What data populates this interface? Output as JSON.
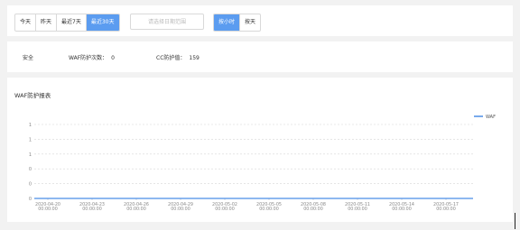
{
  "filters": {
    "ranges": [
      {
        "label": "今天",
        "active": false
      },
      {
        "label": "昨天",
        "active": false
      },
      {
        "label": "最近7天",
        "active": false
      },
      {
        "label": "最近30天",
        "active": true
      }
    ],
    "date_placeholder": "请选择日期范围",
    "units": [
      {
        "label": "按小时",
        "active": true
      },
      {
        "label": "按天",
        "active": false
      }
    ]
  },
  "stats": {
    "safe_label": "安全",
    "waf_label": "WAF防护次数：",
    "waf_value": "0",
    "cc_label": "CC防护值：",
    "cc_value": "159"
  },
  "chart": {
    "title": "WAF防护报表"
  },
  "colors": {
    "accent": "#5b9cf0",
    "series": "#4a8de6"
  },
  "chart_data": {
    "type": "line",
    "title": "WAF防护报表",
    "x_tick_labels": [
      [
        "2020-04-20",
        "00:00:00"
      ],
      [
        "2020-04-23",
        "00:00:00"
      ],
      [
        "2020-04-26",
        "00:00:00"
      ],
      [
        "2020-04-29",
        "00:00:00"
      ],
      [
        "2020-05-02",
        "00:00:00"
      ],
      [
        "2020-05-05",
        "00:00:00"
      ],
      [
        "2020-05-08",
        "00:00:00"
      ],
      [
        "2020-05-11",
        "00:00:00"
      ],
      [
        "2020-05-14",
        "00:00:00"
      ],
      [
        "2020-05-17",
        "00:00:00"
      ]
    ],
    "y_tick_labels": [
      "0",
      "0",
      "0",
      "1",
      "1",
      "1"
    ],
    "ylim": [
      0,
      1
    ],
    "series": [
      {
        "name": "WAF",
        "x": [
          "2020-04-20",
          "2020-05-20"
        ],
        "y": [
          0,
          0
        ]
      }
    ],
    "grid": true,
    "legend": "top-right"
  }
}
